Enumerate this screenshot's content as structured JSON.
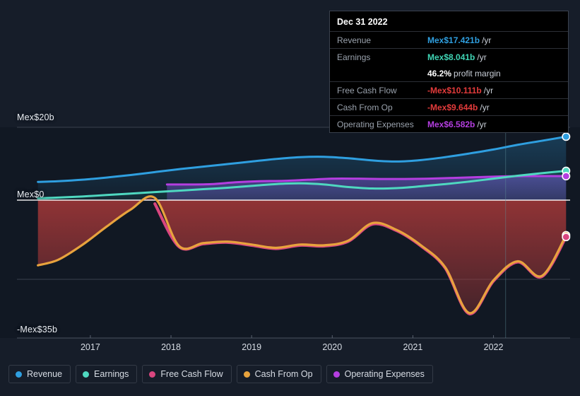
{
  "chart_data": {
    "type": "line",
    "title": "",
    "xlabel": "",
    "ylabel": "",
    "currency_prefix": "Mex$",
    "unit_suffix": "b",
    "ylim": [
      -35,
      20
    ],
    "xlim": [
      2016.3,
      2022.95
    ],
    "grid": true,
    "legend_position": "bottom-left",
    "y_ticks": [
      {
        "value": 20,
        "label": "Mex$20b"
      },
      {
        "value": 0,
        "label": "Mex$0"
      },
      {
        "value": -35,
        "label": "-Mex$35b"
      }
    ],
    "x_ticks": [
      {
        "value": 2017,
        "label": "2017"
      },
      {
        "value": 2018,
        "label": "2018"
      },
      {
        "value": 2019,
        "label": "2019"
      },
      {
        "value": 2020,
        "label": "2020"
      },
      {
        "value": 2021,
        "label": "2021"
      },
      {
        "value": 2022,
        "label": "2022"
      }
    ],
    "forecast_divider_x": 2022.15,
    "series": [
      {
        "name": "Revenue",
        "color": "#2f9fe0",
        "fill": "rgba(47,159,224,0.16)",
        "end_value": 17.421,
        "x": [
          2016.35,
          2016.6,
          2016.9,
          2017.2,
          2017.5,
          2017.8,
          2018.1,
          2018.4,
          2018.7,
          2019.0,
          2019.3,
          2019.6,
          2019.9,
          2020.2,
          2020.5,
          2020.8,
          2021.1,
          2021.4,
          2021.7,
          2022.0,
          2022.3,
          2022.6,
          2022.9
        ],
        "values": [
          5.0,
          5.2,
          5.6,
          6.2,
          6.9,
          7.7,
          8.5,
          9.2,
          9.9,
          10.6,
          11.3,
          11.8,
          11.9,
          11.5,
          10.9,
          10.6,
          11.0,
          11.8,
          12.8,
          13.9,
          15.2,
          16.3,
          17.421
        ]
      },
      {
        "name": "Earnings",
        "color": "#4fd8c0",
        "fill": "rgba(79,216,192,0.13)",
        "end_value": 8.041,
        "x": [
          2016.35,
          2016.6,
          2016.9,
          2017.2,
          2017.5,
          2017.8,
          2018.1,
          2018.4,
          2018.7,
          2019.0,
          2019.3,
          2019.6,
          2019.9,
          2020.2,
          2020.5,
          2020.8,
          2021.1,
          2021.4,
          2021.7,
          2022.0,
          2022.3,
          2022.6,
          2022.9
        ],
        "values": [
          0.5,
          0.7,
          1.0,
          1.4,
          1.8,
          2.2,
          2.6,
          3.0,
          3.4,
          3.9,
          4.4,
          4.6,
          4.3,
          3.6,
          3.2,
          3.3,
          3.8,
          4.4,
          5.1,
          5.9,
          6.7,
          7.4,
          8.041
        ]
      },
      {
        "name": "Free Cash Flow",
        "color": "#d9467f",
        "fill": "rgba(160,45,45,0.55)",
        "end_value": -10.111,
        "x": [
          2017.8,
          2018.1,
          2018.4,
          2018.7,
          2019.0,
          2019.3,
          2019.6,
          2019.9,
          2020.2,
          2020.5,
          2020.8,
          2021.1,
          2021.4,
          2021.7,
          2022.0,
          2022.3,
          2022.6,
          2022.9
        ],
        "values": [
          -1.0,
          -12.8,
          -12.0,
          -11.6,
          -12.4,
          -13.3,
          -12.4,
          -12.6,
          -11.3,
          -6.6,
          -8.4,
          -12.6,
          -18.6,
          -31.2,
          -22.2,
          -17.0,
          -21.0,
          -10.111
        ]
      },
      {
        "name": "Cash From Op",
        "color": "#e8a33d",
        "fill": "rgba(160,45,45,0.0)",
        "end_value": -9.644,
        "x": [
          2016.35,
          2016.6,
          2016.9,
          2017.2,
          2017.5,
          2017.8,
          2018.1,
          2018.4,
          2018.7,
          2019.0,
          2019.3,
          2019.6,
          2019.9,
          2020.2,
          2020.5,
          2020.8,
          2021.1,
          2021.4,
          2021.7,
          2022.0,
          2022.3,
          2022.6,
          2022.9
        ],
        "values": [
          -17.9,
          -16.4,
          -12.3,
          -7.3,
          -2.6,
          0.6,
          -12.6,
          -11.8,
          -11.4,
          -12.2,
          -13.1,
          -12.2,
          -12.4,
          -11.1,
          -6.3,
          -8.2,
          -12.4,
          -18.4,
          -31.0,
          -22.0,
          -16.8,
          -20.8,
          -9.644
        ]
      },
      {
        "name": "Operating Expenses",
        "color": "#b43ee0",
        "fill": "rgba(104,72,190,0.32)",
        "end_value": 6.582,
        "x": [
          2017.95,
          2018.2,
          2018.5,
          2018.8,
          2019.1,
          2019.4,
          2019.7,
          2020.0,
          2020.3,
          2020.6,
          2020.9,
          2021.2,
          2021.5,
          2021.8,
          2022.1,
          2022.4,
          2022.7,
          2022.9
        ],
        "values": [
          4.3,
          4.3,
          4.4,
          4.9,
          5.2,
          5.3,
          5.6,
          5.9,
          5.9,
          5.8,
          5.8,
          5.9,
          6.1,
          6.3,
          6.5,
          6.6,
          6.6,
          6.582
        ]
      }
    ]
  },
  "tooltip": {
    "title": "Dec 31 2022",
    "rows": [
      {
        "key": "Revenue",
        "value": "Mex$17.421b",
        "unit": "/yr",
        "color": "#2f9fe0"
      },
      {
        "key": "Earnings",
        "value": "Mex$8.041b",
        "unit": "/yr",
        "color": "#3fd4b4"
      },
      {
        "key": "",
        "value": "46.2%",
        "unit": "profit margin",
        "color": "#ffffff"
      },
      {
        "key": "Free Cash Flow",
        "value": "-Mex$10.111b",
        "unit": "/yr",
        "color": "#e33b3b"
      },
      {
        "key": "Cash From Op",
        "value": "-Mex$9.644b",
        "unit": "/yr",
        "color": "#e33b3b"
      },
      {
        "key": "Operating Expenses",
        "value": "Mex$6.582b",
        "unit": "/yr",
        "color": "#b43ee0"
      }
    ]
  },
  "legend": {
    "items": [
      {
        "label": "Revenue",
        "color": "#2f9fe0"
      },
      {
        "label": "Earnings",
        "color": "#4fd8c0"
      },
      {
        "label": "Free Cash Flow",
        "color": "#d9467f"
      },
      {
        "label": "Cash From Op",
        "color": "#e8a33d"
      },
      {
        "label": "Operating Expenses",
        "color": "#b43ee0"
      }
    ]
  },
  "axis_labels": {
    "top": "Mex$20b",
    "zero": "Mex$0",
    "bottom": "-Mex$35b"
  }
}
